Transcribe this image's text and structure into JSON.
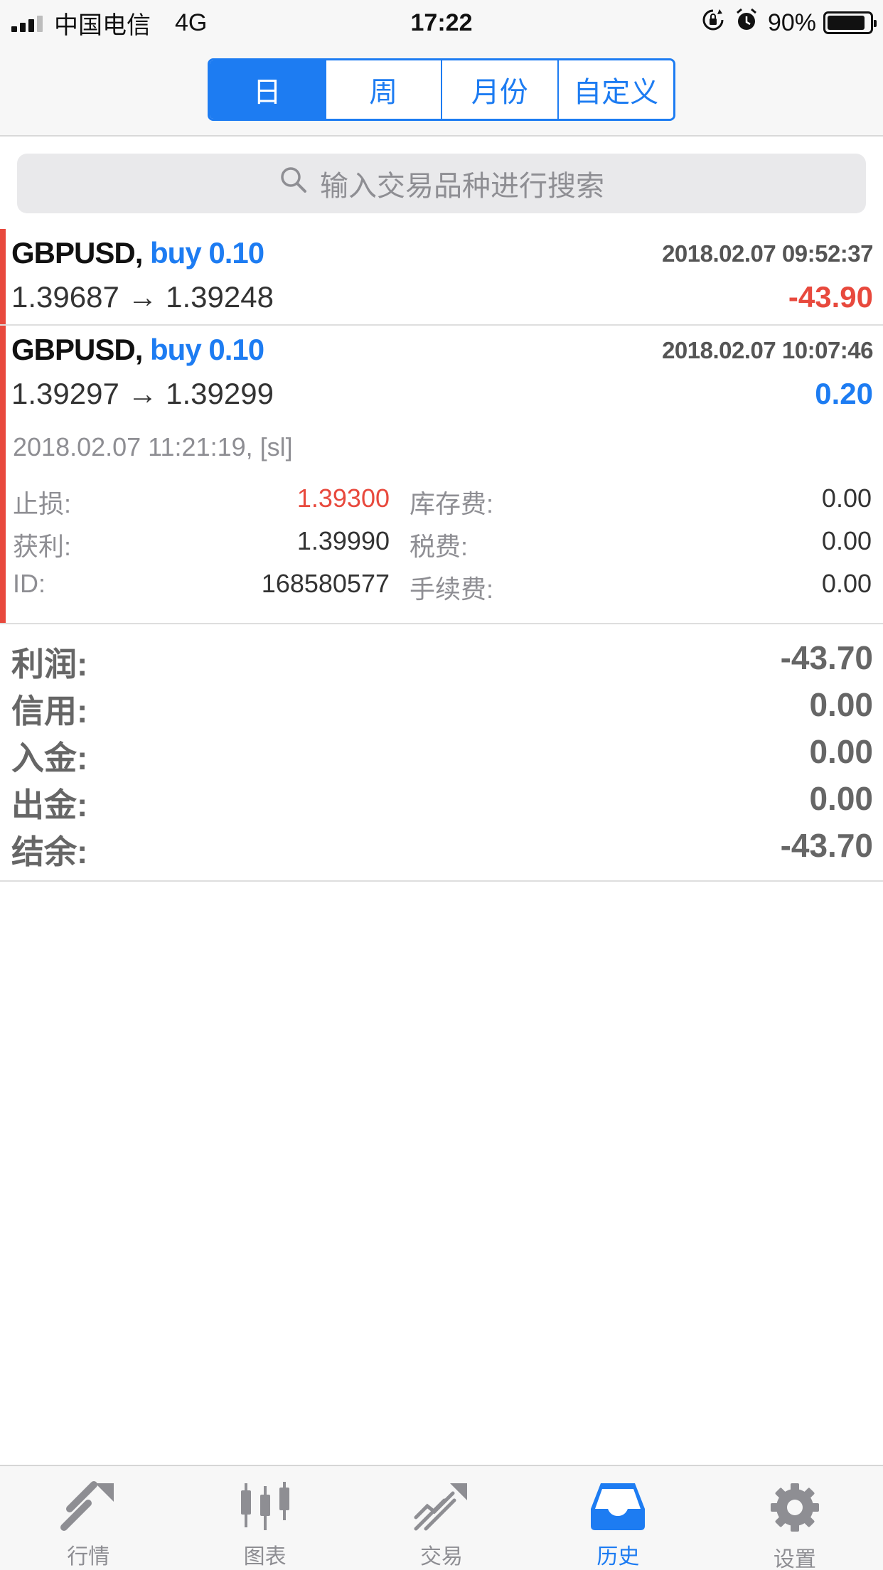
{
  "status_bar": {
    "carrier": "中国电信",
    "network": "4G",
    "time": "17:22",
    "battery": "90%",
    "battery_level": 0.9
  },
  "period_tabs": [
    "日",
    "周",
    "月份",
    "自定义"
  ],
  "active_period": "日",
  "search": {
    "placeholder": "输入交易品种进行搜索"
  },
  "deals": [
    {
      "symbol": "GBPUSD,",
      "side": "buy 0.10",
      "time": "2018.02.07 09:52:37",
      "prices": "1.39687 → 1.39248",
      "profit": "-43.90"
    },
    {
      "symbol": "GBPUSD,",
      "side": "buy 0.10",
      "time": "2018.02.07 10:07:46",
      "prices": "1.39297 → 1.39299",
      "profit": "0.20",
      "close_info": "2018.02.07 11:21:19, [sl]",
      "details": {
        "sl_label": "止损:",
        "sl_value": "1.39300",
        "tp_label": "获利:",
        "tp_value": "1.39990",
        "id_label": "ID:",
        "id_value": "168580577",
        "swap_label": "库存费:",
        "swap_value": "0.00",
        "tax_label": "税费:",
        "tax_value": "0.00",
        "commission_label": "手续费:",
        "commission_value": "0.00"
      }
    }
  ],
  "summary": {
    "profit_label": "利润:",
    "profit_value": "-43.70",
    "credit_label": "信用:",
    "credit_value": "0.00",
    "deposit_label": "入金:",
    "deposit_value": "0.00",
    "withdrawal_label": "出金:",
    "withdrawal_value": "0.00",
    "balance_label": "结余:",
    "balance_value": "-43.70"
  },
  "tab_bar": [
    {
      "label": "行情",
      "icon": "quotes-icon"
    },
    {
      "label": "图表",
      "icon": "chart-icon"
    },
    {
      "label": "交易",
      "icon": "trade-icon"
    },
    {
      "label": "历史",
      "icon": "history-icon"
    },
    {
      "label": "设置",
      "icon": "settings-icon"
    }
  ],
  "active_tab": "历史",
  "colors": {
    "accent": "#1d7cf2",
    "loss": "#e8493d",
    "muted": "#8e8e93"
  }
}
